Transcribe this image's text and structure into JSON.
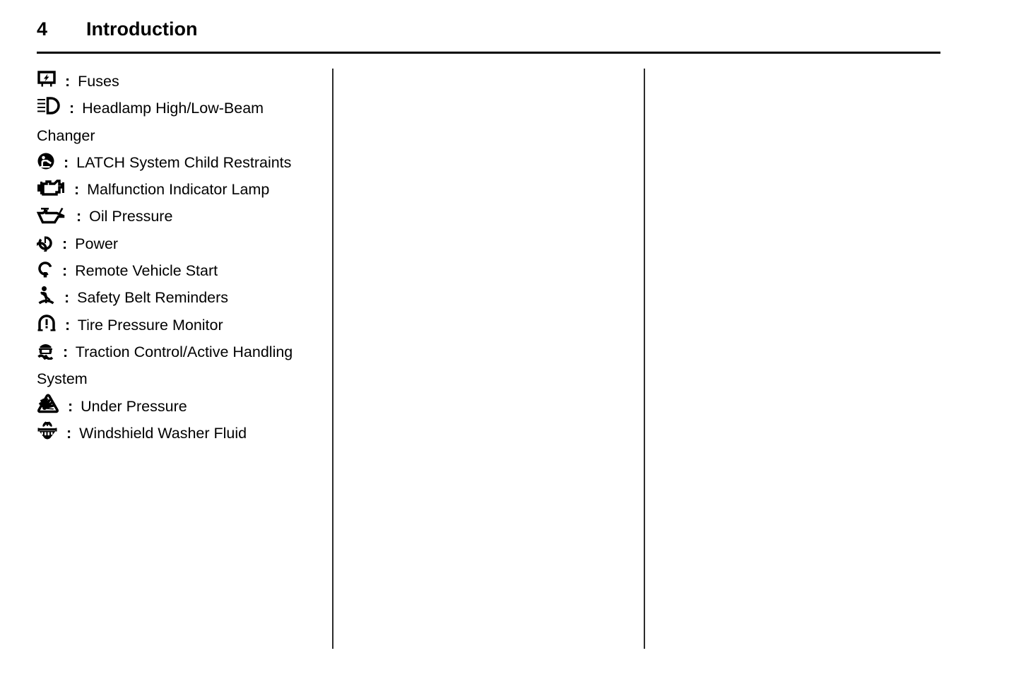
{
  "page": {
    "number": "4",
    "title": "Introduction"
  },
  "separator_color": "#000000",
  "column_rule_color": "#2b2b2b",
  "symbols": {
    "separator": ":",
    "items": [
      {
        "icon": "fuse-icon",
        "label": "Fuses"
      },
      {
        "icon": "headlamp-beam-icon",
        "label": "Headlamp High/Low-Beam Changer"
      },
      {
        "icon": "latch-child-seat-icon",
        "label": "LATCH System Child Restraints"
      },
      {
        "icon": "engine-icon",
        "label": "Malfunction Indicator Lamp"
      },
      {
        "icon": "oil-can-icon",
        "label": "Oil Pressure"
      },
      {
        "icon": "power-icon",
        "label": "Power"
      },
      {
        "icon": "remote-start-icon",
        "label": "Remote Vehicle Start"
      },
      {
        "icon": "safety-belt-icon",
        "label": "Safety Belt Reminders"
      },
      {
        "icon": "tire-pressure-icon",
        "label": "Tire Pressure Monitor"
      },
      {
        "icon": "traction-control-icon",
        "label": "Traction Control/Active Handling System"
      },
      {
        "icon": "under-pressure-icon",
        "label": "Under Pressure"
      },
      {
        "icon": "windshield-washer-icon",
        "label": "Windshield Washer Fluid"
      }
    ]
  }
}
